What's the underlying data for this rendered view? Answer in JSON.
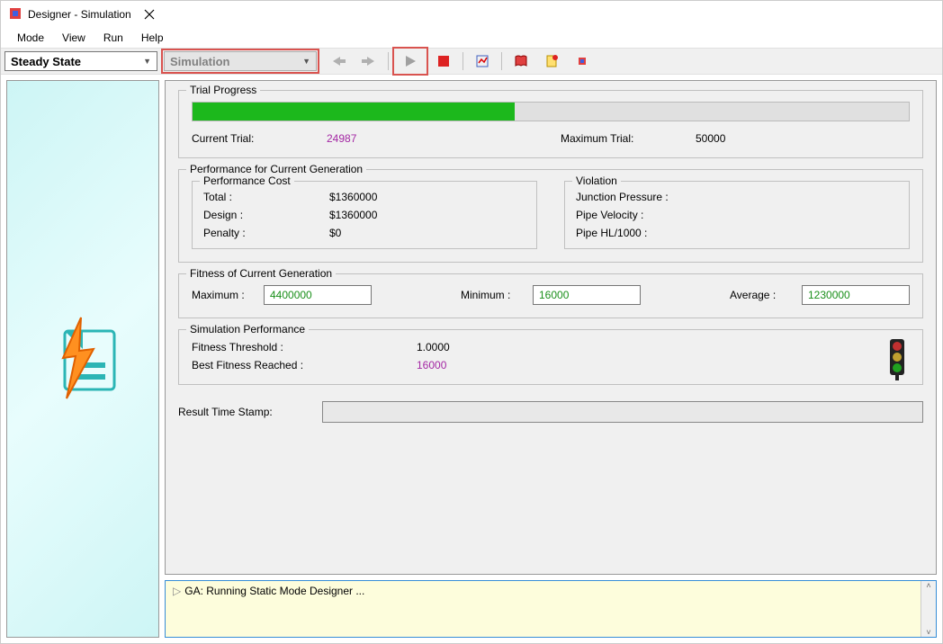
{
  "window": {
    "title": "Designer - Simulation"
  },
  "menu": {
    "items": [
      "Mode",
      "View",
      "Run",
      "Help"
    ]
  },
  "toolbar": {
    "mode_select": "Steady State",
    "sim_select": "Simulation"
  },
  "trial_progress": {
    "title": "Trial Progress",
    "percent": 50,
    "current_label": "Current Trial:",
    "current_value": "24987",
    "max_label": "Maximum Trial:",
    "max_value": "50000"
  },
  "performance": {
    "title": "Performance for Current Generation",
    "cost": {
      "title": "Performance Cost",
      "total_label": "Total :",
      "total_value": "$1360000",
      "design_label": "Design :",
      "design_value": "$1360000",
      "penalty_label": "Penalty :",
      "penalty_value": "$0"
    },
    "violation": {
      "title": "Violation",
      "junction_label": "Junction Pressure :",
      "junction_value": "",
      "velocity_label": "Pipe Velocity :",
      "velocity_value": "",
      "hl_label": "Pipe HL/1000 :",
      "hl_value": ""
    }
  },
  "fitness": {
    "title": "Fitness of Current Generation",
    "max_label": "Maximum :",
    "max_value": "4400000",
    "min_label": "Minimum :",
    "min_value": "16000",
    "avg_label": "Average :",
    "avg_value": "1230000"
  },
  "sim_perf": {
    "title": "Simulation Performance",
    "threshold_label": "Fitness Threshold :",
    "threshold_value": "1.0000",
    "best_label": "Best Fitness Reached :",
    "best_value": "16000"
  },
  "timestamp": {
    "label": "Result Time Stamp:",
    "value": ""
  },
  "log": {
    "line1": "GA: Running Static Mode Designer ..."
  }
}
